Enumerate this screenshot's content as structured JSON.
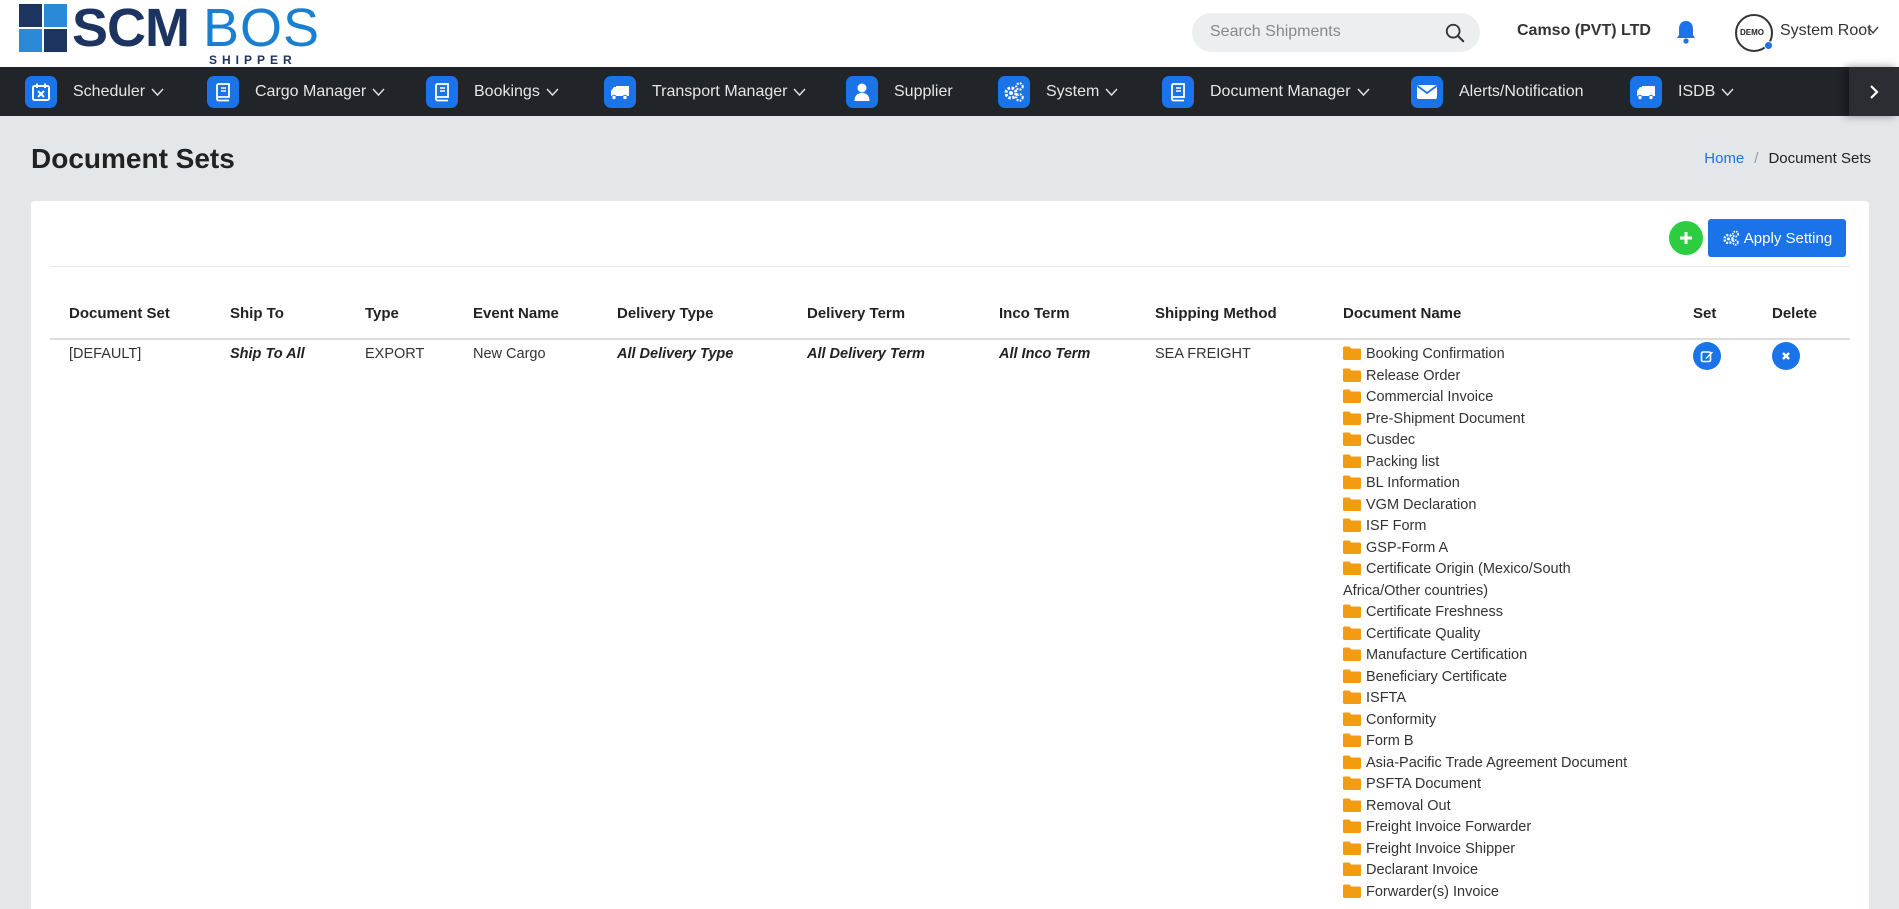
{
  "brand": {
    "name_part1": "SCM",
    "name_part2": "BOS",
    "tagline": "SHIPPER"
  },
  "header": {
    "search_placeholder": "Search Shipments",
    "company": "Camso (PVT) LTD",
    "avatar_text": "DEMO",
    "user": "System Root"
  },
  "nav": [
    {
      "label": "Scheduler",
      "icon": "calendar-icon",
      "dropdown": true
    },
    {
      "label": "Cargo Manager",
      "icon": "book-icon",
      "dropdown": true
    },
    {
      "label": "Bookings",
      "icon": "book-icon",
      "dropdown": true
    },
    {
      "label": "Transport Manager",
      "icon": "truck-icon",
      "dropdown": true
    },
    {
      "label": "Supplier",
      "icon": "user-icon",
      "dropdown": false
    },
    {
      "label": "System",
      "icon": "gears-icon",
      "dropdown": true
    },
    {
      "label": "Document Manager",
      "icon": "book-icon",
      "dropdown": true
    },
    {
      "label": "Alerts/Notification",
      "icon": "envelope-icon",
      "dropdown": false
    },
    {
      "label": "ISDB",
      "icon": "truck-icon",
      "dropdown": true
    }
  ],
  "page": {
    "title": "Document Sets",
    "breadcrumb_home": "Home",
    "breadcrumb_current": "Document Sets"
  },
  "toolbar": {
    "apply_label": "Apply Setting"
  },
  "table": {
    "headers": [
      "Document Set",
      "Ship To",
      "Type",
      "Event Name",
      "Delivery Type",
      "Delivery Term",
      "Inco Term",
      "Shipping Method",
      "Document Name",
      "Set",
      "Delete"
    ],
    "row": {
      "document_set": "[DEFAULT]",
      "ship_to": "Ship To All",
      "type": "EXPORT",
      "event_name": "New Cargo",
      "delivery_type": "All Delivery Type",
      "delivery_term": "All Delivery Term",
      "inco_term": "All Inco Term",
      "shipping_method": "SEA FREIGHT",
      "documents": [
        "Booking Confirmation",
        "Release Order",
        "Commercial Invoice",
        "Pre-Shipment Document",
        "Cusdec",
        "Packing list",
        "BL Information",
        "VGM Declaration",
        "ISF Form",
        "GSP-Form A",
        "Certificate Origin (Mexico/South Africa/Other countries)",
        "Certificate Freshness",
        "Certificate Quality",
        "Manufacture Certification",
        "Beneficiary Certificate",
        "ISFTA",
        "Conformity",
        "Form B",
        "Asia-Pacific Trade Agreement Document",
        "PSFTA Document",
        "Removal Out",
        "Freight Invoice Forwarder",
        "Freight Invoice Shipper",
        "Declarant Invoice",
        "Forwarder(s) Invoice"
      ]
    }
  },
  "colors": {
    "accent": "#1a73e8",
    "nav_bg": "#212529",
    "folder": "#f39c12",
    "add_button": "#2ecc40"
  }
}
